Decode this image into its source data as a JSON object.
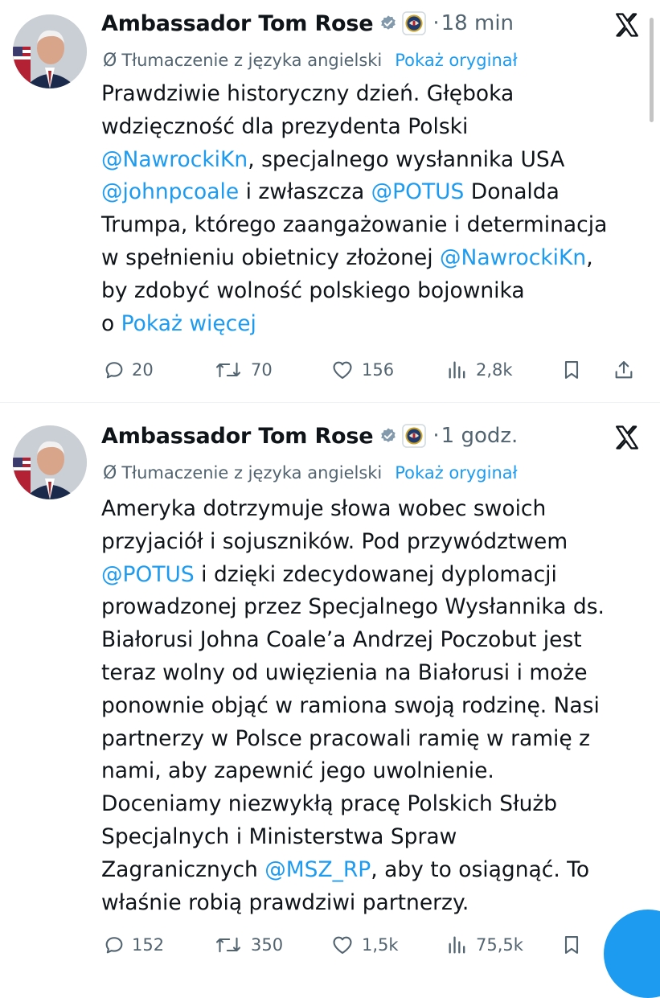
{
  "tweets": [
    {
      "author": "Ambassador Tom Rose",
      "time": "18 min",
      "translation_label": "Tłumaczenie z języka angielski",
      "show_original": "Pokaż oryginał",
      "text_lines": [
        [
          {
            "t": "Prawdziwie historyczny dzień. Głęboka"
          }
        ],
        [
          {
            "t": "wdzięczność dla prezydenta Polski"
          }
        ],
        [
          {
            "t": "@NawrockiKn",
            "k": "mention"
          },
          {
            "t": ", specjalnego wysłannika USA"
          }
        ],
        [
          {
            "t": "@johnpcoale",
            "k": "mention"
          },
          {
            "t": " i zwłaszcza "
          },
          {
            "t": "@POTUS",
            "k": "mention"
          },
          {
            "t": " Donalda"
          }
        ],
        [
          {
            "t": "Trumpa, którego zaangażowanie i determinacja"
          }
        ],
        [
          {
            "t": "w spełnieniu obietnicy złożonej "
          },
          {
            "t": "@NawrockiKn",
            "k": "mention"
          },
          {
            "t": ","
          }
        ],
        [
          {
            "t": "by zdobyć wolność polskiego bojownika"
          }
        ],
        [
          {
            "t": "o "
          },
          {
            "t": "Pokaż więcej",
            "k": "link"
          }
        ]
      ],
      "replies": "20",
      "reposts": "70",
      "likes": "156",
      "views": "2,8k"
    },
    {
      "author": "Ambassador Tom Rose",
      "time": "1 godz.",
      "translation_label": "Tłumaczenie z języka angielski",
      "show_original": "Pokaż oryginał",
      "text_lines": [
        [
          {
            "t": "Ameryka dotrzymuje słowa wobec swoich"
          }
        ],
        [
          {
            "t": "przyjaciół i sojuszników. Pod przywództwem"
          }
        ],
        [
          {
            "t": "@POTUS",
            "k": "mention"
          },
          {
            "t": " i dzięki zdecydowanej dyplomacji"
          }
        ],
        [
          {
            "t": "prowadzonej przez Specjalnego Wysłannika ds."
          }
        ],
        [
          {
            "t": "Białorusi Johna Coale’a Andrzej Poczobut jest"
          }
        ],
        [
          {
            "t": "teraz wolny od uwięzienia na Białorusi i może"
          }
        ],
        [
          {
            "t": "ponownie objąć w ramiona swoją rodzinę. Nasi"
          }
        ],
        [
          {
            "t": "partnerzy w Polsce pracowali ramię w ramię z"
          }
        ],
        [
          {
            "t": "nami, aby zapewnić jego uwolnienie."
          }
        ],
        [
          {
            "t": "Doceniamy niezwykłą pracę Polskich Służb"
          }
        ],
        [
          {
            "t": "Specjalnych i Ministerstwa Spraw"
          }
        ],
        [
          {
            "t": "Zagranicznych "
          },
          {
            "t": "@MSZ_RP",
            "k": "mention"
          },
          {
            "t": ", aby to osiągnąć. To"
          }
        ],
        [
          {
            "t": "właśnie robią prawdziwi partnerzy."
          }
        ]
      ],
      "replies": "152",
      "reposts": "350",
      "likes": "1,5k",
      "views": "75,5k"
    }
  ],
  "separator": "·",
  "colors": {
    "text": "#0f1419",
    "secondary": "#536471",
    "link": "#1d9bf0",
    "verified": "#829aab"
  },
  "icons": [
    "verified-badge-icon",
    "state-department-seal-icon",
    "x-logo-icon",
    "translate-icon",
    "reply-icon",
    "repost-icon",
    "like-icon",
    "views-icon",
    "bookmark-icon",
    "share-icon"
  ]
}
